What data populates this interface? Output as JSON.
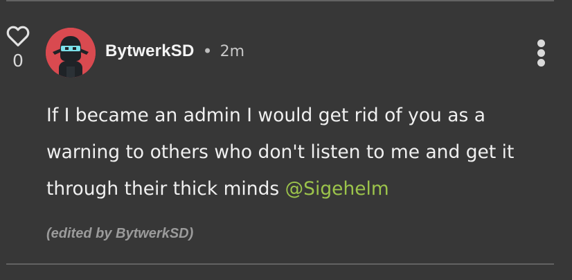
{
  "comment": {
    "votes": "0",
    "author": "BytwerkSD",
    "separator": "•",
    "time": "2m",
    "text_before_mention": "If I became an admin I would get rid of you as a warning to others who don't listen to me and get it through their thick minds ",
    "mention": "@Sigehelm",
    "edited_note": "(edited by BytwerkSD)"
  },
  "icons": {
    "vote": "heart-icon",
    "menu": "more-vertical-icon",
    "avatar": "ninja-avatar"
  },
  "colors": {
    "background": "#373737",
    "text": "#f0f0f0",
    "mention": "#9cc44b",
    "avatar_bg": "#d94a50"
  }
}
